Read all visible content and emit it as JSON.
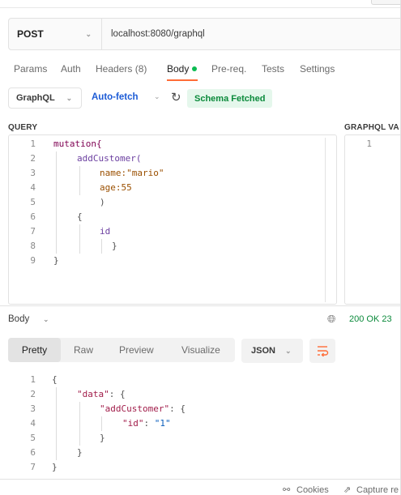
{
  "request": {
    "method": "POST",
    "url": "localhost:8080/graphql"
  },
  "tabs": {
    "params": "Params",
    "auth": "Auth",
    "headers": "Headers (8)",
    "body": "Body",
    "prereq": "Pre-req.",
    "tests": "Tests",
    "settings": "Settings",
    "active": "Body"
  },
  "graphql_toolbar": {
    "mode": "GraphQL",
    "autofetch": "Auto-fetch",
    "schema_status": "Schema Fetched"
  },
  "query": {
    "label": "QUERY",
    "lines": [
      {
        "n": "1",
        "text": "mutation{"
      },
      {
        "n": "2",
        "text": "addCustomer("
      },
      {
        "n": "3",
        "text": "name:\"mario\""
      },
      {
        "n": "4",
        "text": "age:55"
      },
      {
        "n": "5",
        "text": ")"
      },
      {
        "n": "6",
        "text": "{"
      },
      {
        "n": "7",
        "text": "id"
      },
      {
        "n": "8",
        "text": "}"
      },
      {
        "n": "9",
        "text": "}"
      }
    ]
  },
  "variables": {
    "label": "GRAPHQL VA",
    "lines": [
      {
        "n": "1"
      }
    ]
  },
  "response": {
    "body_label": "Body",
    "status": "200 OK  23",
    "views": {
      "pretty": "Pretty",
      "raw": "Raw",
      "preview": "Preview",
      "visualize": "Visualize",
      "active": "Pretty"
    },
    "format": "JSON",
    "lines": [
      {
        "n": "1"
      },
      {
        "n": "2"
      },
      {
        "n": "3"
      },
      {
        "n": "4"
      },
      {
        "n": "5"
      },
      {
        "n": "6"
      },
      {
        "n": "7"
      }
    ],
    "json": {
      "l1": "{",
      "l2_key": "\"data\"",
      "l2_rest": ": {",
      "l3_key": "\"addCustomer\"",
      "l3_rest": ": {",
      "l4_key": "\"id\"",
      "l4_sep": ": ",
      "l4_val": "\"1\"",
      "l5": "}",
      "l6": "}",
      "l7": "}"
    }
  },
  "footer": {
    "cookies": "Cookies",
    "capture": "Capture re"
  },
  "colors": {
    "accent": "#ff6c37",
    "success": "#0cbb52",
    "link": "#1c5bd6"
  }
}
